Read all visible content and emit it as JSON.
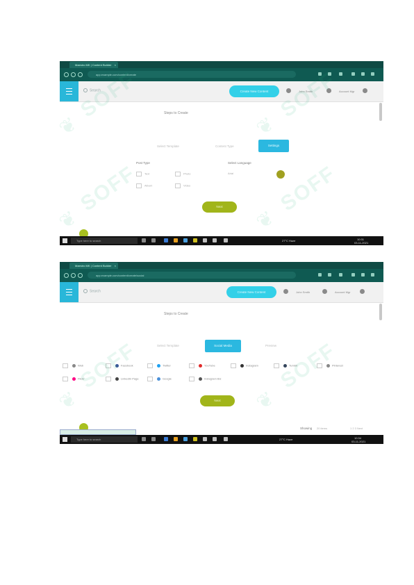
{
  "watermark": "SOFF",
  "screens": [
    {
      "tab_title": "Maestro MK | Content Builder",
      "url": "app.example.com/content/create",
      "search_placeholder": "Search",
      "cta_label": "Create New Content",
      "user1": "John Smith",
      "user2": "Account Mgr",
      "page_heading": "Steps to Create",
      "steps": [
        "Select Template",
        "Content Type",
        "Settings"
      ],
      "active_step": "Settings",
      "content_type_label": "Post Type",
      "content_options": [
        "Text",
        "Photo",
        "Album",
        "Video"
      ],
      "select_language_label": "Select Language",
      "language_value": "Arial",
      "next_label": "Next",
      "taskbar_search": "Type here to search",
      "taskbar_time": "10:31",
      "taskbar_date": "03-11-2021",
      "weather": "27°C Haze"
    },
    {
      "tab_title": "Maestro MK | Content Builder",
      "url": "app.example.com/content/create/social",
      "search_placeholder": "Search",
      "cta_label": "Create New Content",
      "user1": "John Smith",
      "user2": "Account Mgr",
      "page_heading": "Steps to Create",
      "steps": [
        "Select Template",
        "Social Media",
        "Preview"
      ],
      "active_step": "Social Media",
      "social_row1": [
        {
          "name": "Web",
          "color": "#888888"
        },
        {
          "name": "Facebook",
          "color": "#3b5998"
        },
        {
          "name": "Twitter",
          "color": "#1da1f2"
        },
        {
          "name": "YouTube",
          "color": "#e02a2a"
        },
        {
          "name": "Instagram",
          "color": "#333333"
        },
        {
          "name": "Tumblr",
          "color": "#35465c"
        },
        {
          "name": "Pinterest",
          "color": "#888888"
        }
      ],
      "social_row2": [
        {
          "name": "Flickr",
          "color": "#ff0084"
        },
        {
          "name": "LinkedIn Page",
          "color": "#444444"
        },
        {
          "name": "Google",
          "color": "#4a90d9"
        },
        {
          "name": "Instagram Biz",
          "color": "#555555"
        }
      ],
      "next_label": "Next",
      "footer_label": "Showing",
      "footer_value": "20 items",
      "footer_page": "1 2 3 Next",
      "taskbar_search": "Type here to search",
      "taskbar_time": "10:34",
      "taskbar_date": "03-11-2021",
      "weather": "27°C Haze"
    }
  ]
}
